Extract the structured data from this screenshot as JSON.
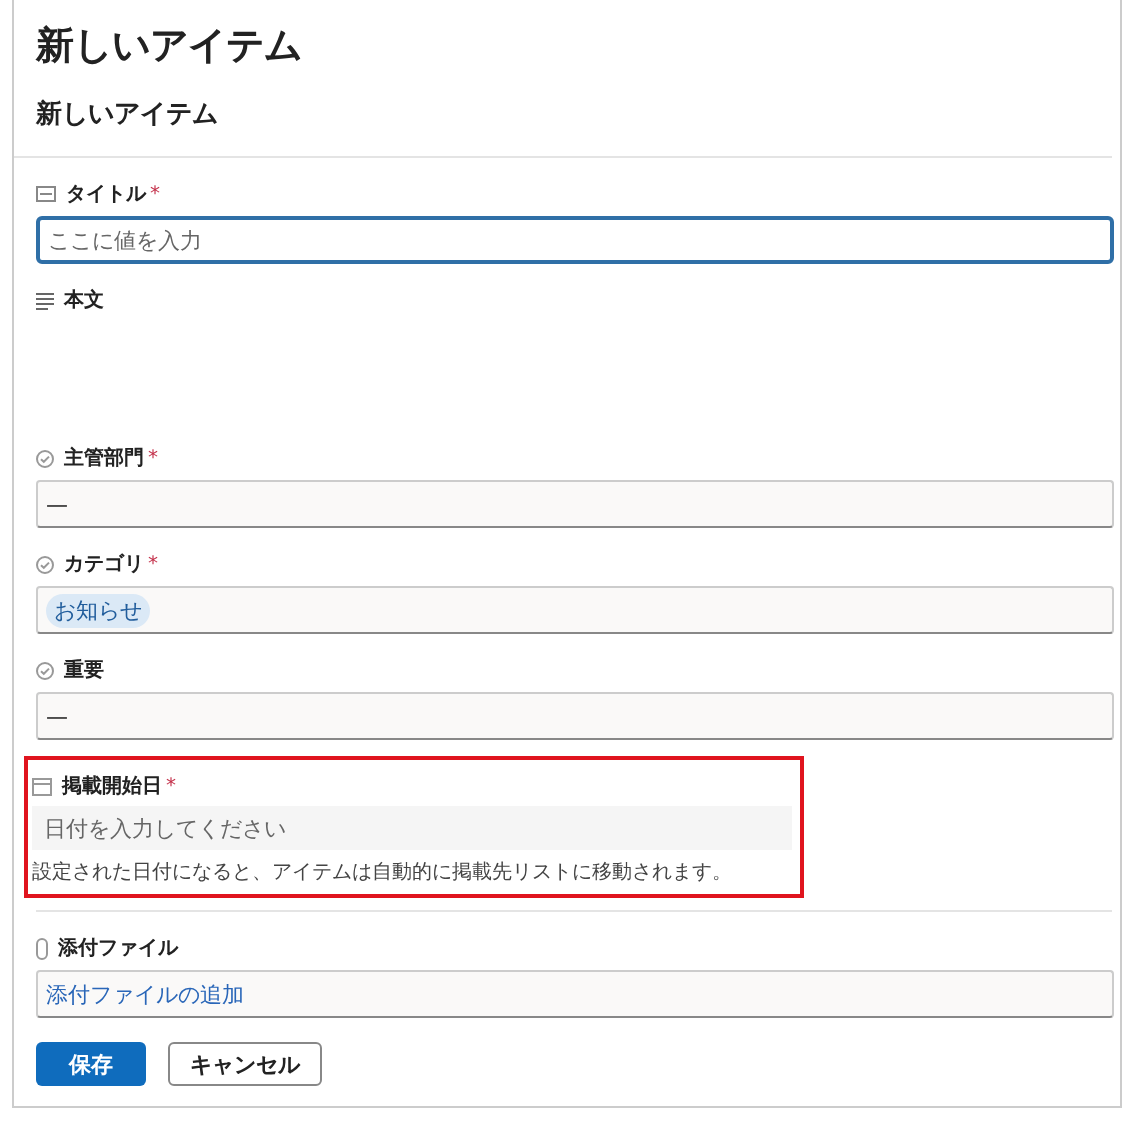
{
  "page_title": "新しいアイテム",
  "form_title": "新しいアイテム",
  "fields": [
    {
      "kind": "text",
      "label": "タイトル",
      "required_mark": "*",
      "placeholder": "ここに値を入力",
      "focused": true,
      "highlighted": false
    },
    {
      "kind": "richtext",
      "label": "本文",
      "highlighted": false
    },
    {
      "kind": "choice",
      "label": "主管部門",
      "required_mark": "*",
      "value": "—",
      "highlighted": false
    },
    {
      "kind": "tags",
      "label": "カテゴリ",
      "required_mark": "*",
      "tags": [
        "お知らせ"
      ],
      "highlighted": false
    },
    {
      "kind": "choice",
      "label": "重要",
      "value": "—",
      "highlighted": false
    },
    {
      "kind": "date",
      "label": "掲載開始日",
      "required_mark": "*",
      "placeholder": "日付を入力してください",
      "hint": "設定された日付になると、アイテムは自動的に掲載先リストに移動されます。",
      "highlighted": true
    },
    {
      "kind": "attachment",
      "label": "添付ファイル",
      "link": "添付ファイルの追加",
      "highlighted": false
    }
  ],
  "buttons": [
    {
      "label": "保存",
      "primary": true
    },
    {
      "label": "キャンセル",
      "primary": false
    }
  ]
}
